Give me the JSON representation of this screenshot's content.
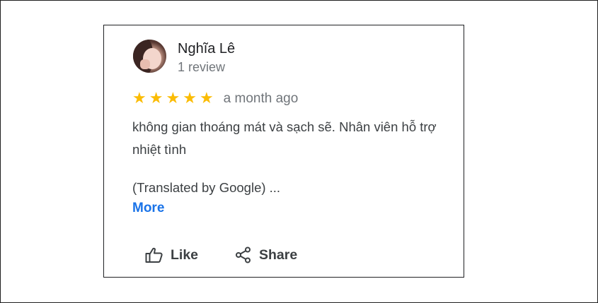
{
  "review": {
    "author_name": "Nghĩa Lê",
    "author_reviews": "1 review",
    "rating": 5,
    "rating_max": 5,
    "time_ago": "a month ago",
    "text_line": "không gian thoáng mát và sạch sẽ. Nhân viên hỗ trợ nhiệt tình",
    "translated_label": "(Translated by Google) ...",
    "more_label": "More"
  },
  "actions": {
    "like_label": "Like",
    "share_label": "Share"
  },
  "colors": {
    "star": "#fbbc04",
    "link": "#1a73e8",
    "secondary_text": "#70757a",
    "primary_text": "#202124"
  },
  "icons": {
    "like": "thumbs-up-icon",
    "share": "share-icon",
    "star": "star-icon"
  }
}
